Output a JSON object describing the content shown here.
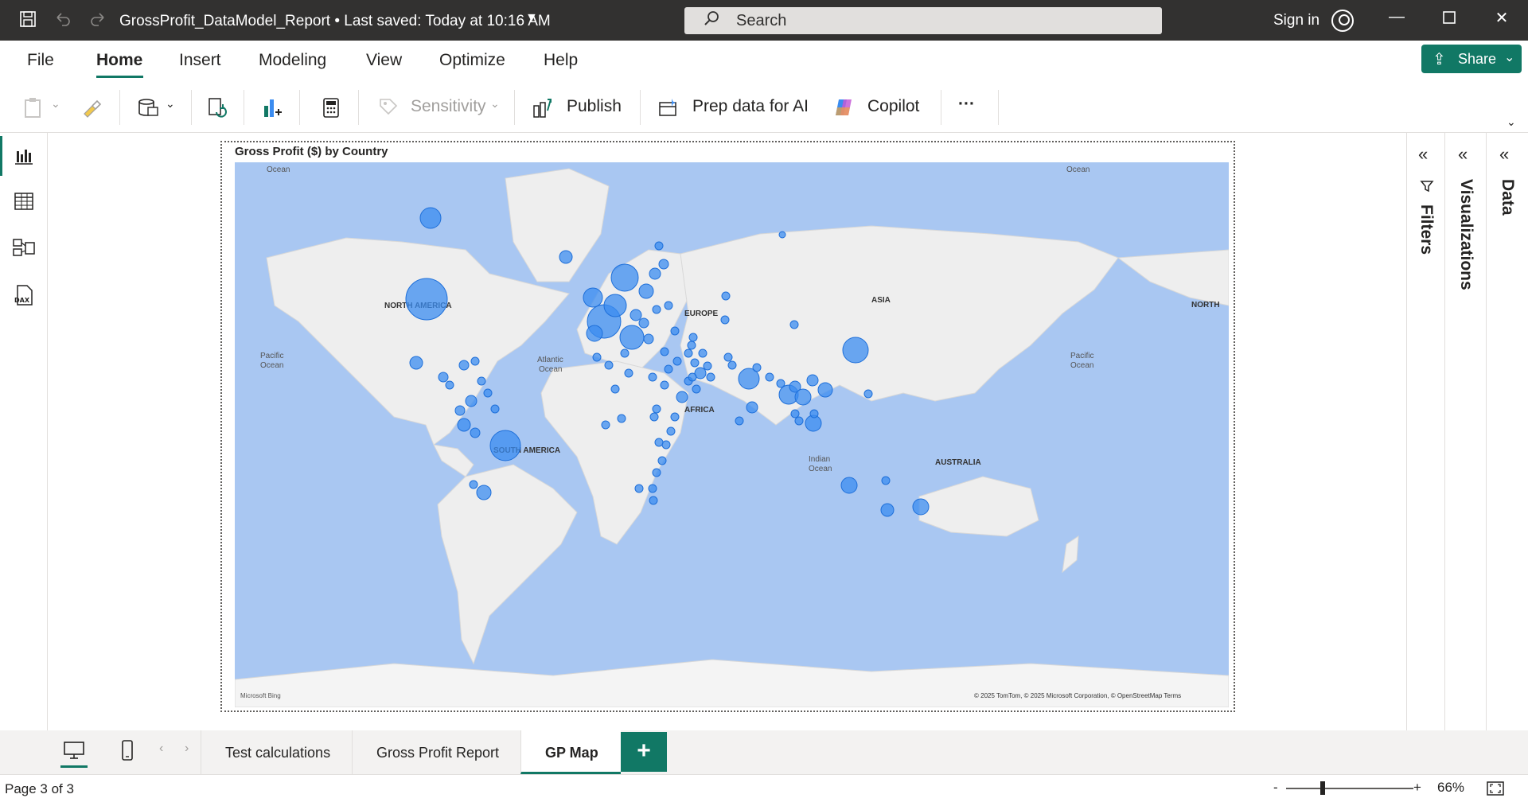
{
  "titlebar": {
    "title": "GrossProfit_DataModel_Report • Last saved: Today at 10:16 AM",
    "search_placeholder": "Search",
    "signin_label": "Sign in"
  },
  "menu": {
    "items": [
      "File",
      "Home",
      "Insert",
      "Modeling",
      "View",
      "Optimize",
      "Help"
    ],
    "active": "Home",
    "share_label": "Share"
  },
  "ribbon": {
    "sensitivity_label": "Sensitivity",
    "publish_label": "Publish",
    "prep_label": "Prep data for AI",
    "copilot_label": "Copilot",
    "more_label": "···"
  },
  "visual": {
    "title": "Gross Profit ($) by Country",
    "attribution": "© 2025 TomTom, © 2025 Microsoft Corporation, © OpenStreetMap  Terms",
    "logo_text": "Microsoft Bing",
    "labels": {
      "north_america": "NORTH AMERICA",
      "south_america": "SOUTH AMERICA",
      "europe": "EUROPE",
      "africa": "AFRICA",
      "asia": "ASIA",
      "australia": "AUSTRALIA",
      "north": "NORTH",
      "pacific": "Pacific",
      "atlantic": "Atlantic",
      "indian": "Indian",
      "ocean": "Ocean"
    }
  },
  "panes": {
    "filters": "Filters",
    "visualizations": "Visualizations",
    "data": "Data"
  },
  "pages": {
    "tabs": [
      "Test calculations",
      "Gross Profit Report",
      "GP Map"
    ],
    "active": "GP Map",
    "add_label": "+"
  },
  "status": {
    "page_indicator": "Page 3 of 3",
    "zoom_minus": "-",
    "zoom_plus": "+",
    "zoom_level": "66%"
  },
  "colors": {
    "accent": "#117865",
    "bubble": "#3b8cf0",
    "water": "#a9c7f2",
    "land": "#eeeeee"
  }
}
